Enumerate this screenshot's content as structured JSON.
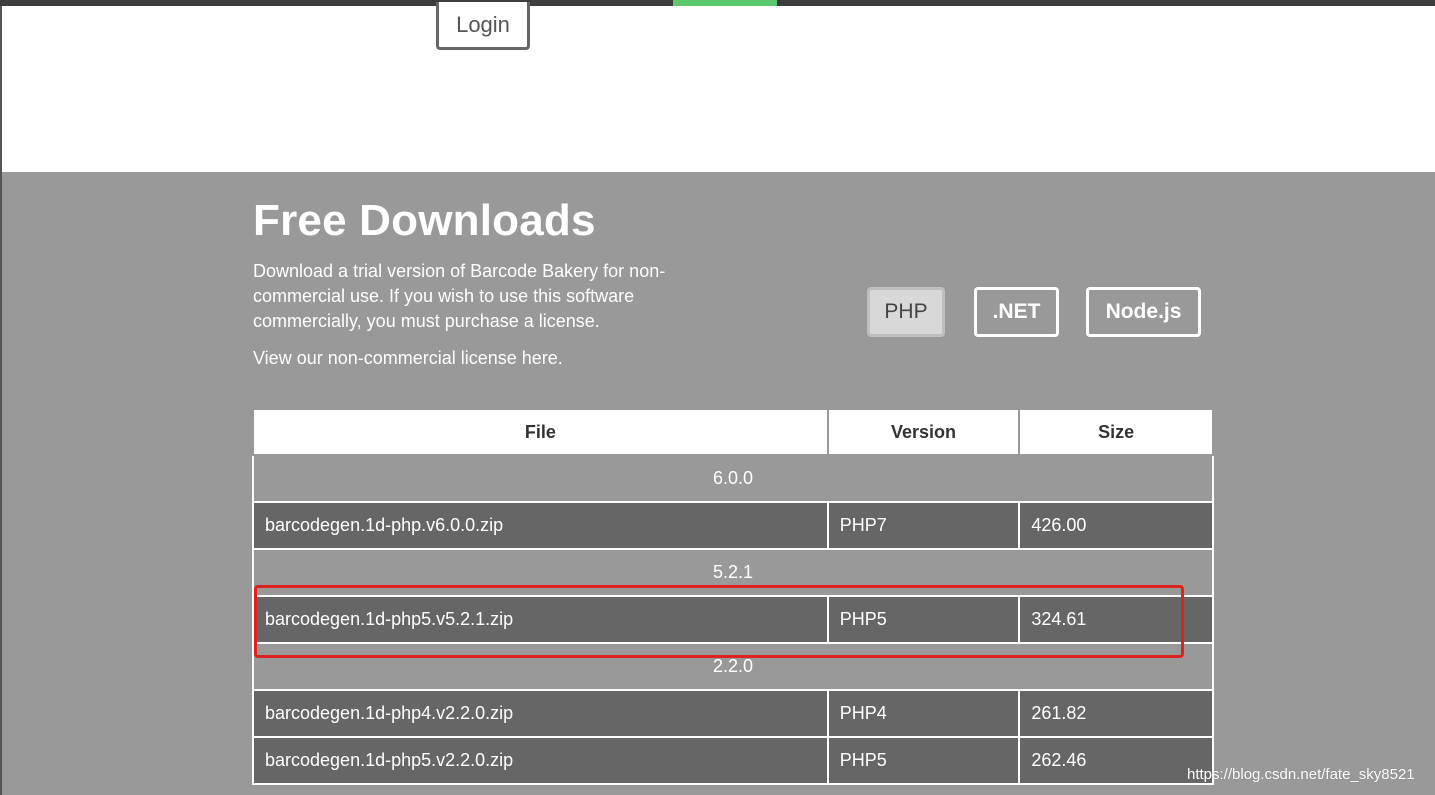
{
  "header": {
    "login_label": "Login"
  },
  "section": {
    "title": "Free Downloads",
    "description": "Download a trial version of Barcode Bakery for non-commercial use. If you wish to use this software commercially, you must purchase a license.",
    "license_link": "View our non-commercial license here."
  },
  "tabs": [
    {
      "label": "PHP",
      "selected": true
    },
    {
      "label": ".NET",
      "selected": false
    },
    {
      "label": "Node.js",
      "selected": false
    }
  ],
  "table": {
    "headers": {
      "file": "File",
      "version": "Version",
      "size": "Size"
    },
    "groups": [
      {
        "label": "6.0.0",
        "files": [
          {
            "name": "barcodegen.1d-php.v6.0.0.zip",
            "version": "PHP7",
            "size": "426.00"
          }
        ]
      },
      {
        "label": "5.2.1",
        "files": [
          {
            "name": "barcodegen.1d-php5.v5.2.1.zip",
            "version": "PHP5",
            "size": "324.61"
          }
        ]
      },
      {
        "label": "2.2.0",
        "files": [
          {
            "name": "barcodegen.1d-php4.v2.2.0.zip",
            "version": "PHP4",
            "size": "261.82"
          },
          {
            "name": "barcodegen.1d-php5.v2.2.0.zip",
            "version": "PHP5",
            "size": "262.46"
          }
        ]
      }
    ]
  },
  "watermark": "https://blog.csdn.net/fate_sky8521",
  "colors": {
    "accent": "#5cc96f",
    "highlight": "#e0221f",
    "section_bg": "#999999",
    "row_bg": "#666666"
  }
}
